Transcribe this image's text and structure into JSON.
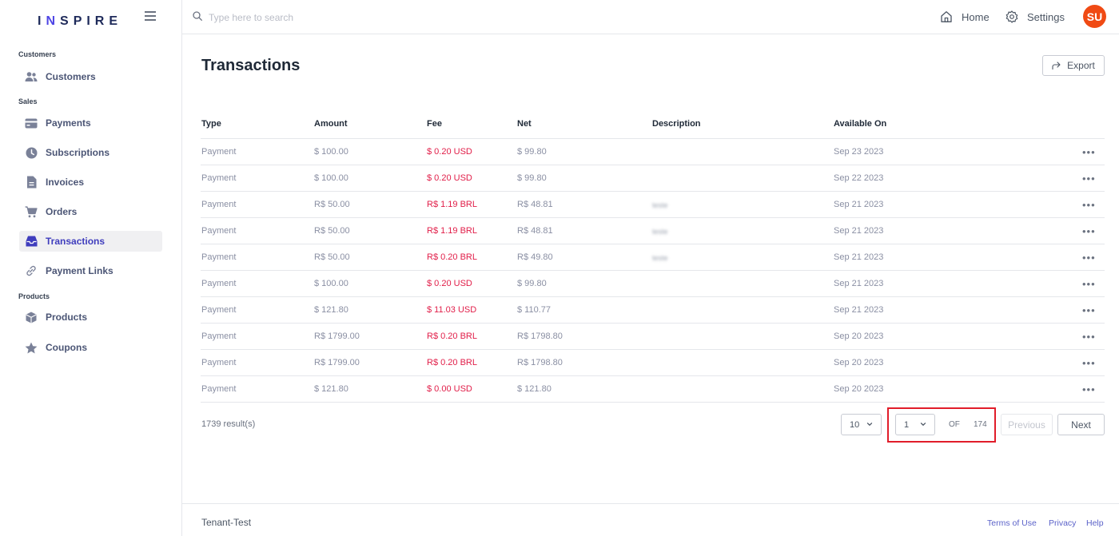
{
  "brand": {
    "prefix": "I",
    "accent": "N",
    "suffix": "SPIRE"
  },
  "sidebar": {
    "sections": [
      {
        "label": "Customers",
        "items": [
          {
            "label": "Customers",
            "icon": "users-icon"
          }
        ]
      },
      {
        "label": "Sales",
        "items": [
          {
            "label": "Payments",
            "icon": "credit-card-icon"
          },
          {
            "label": "Subscriptions",
            "icon": "clock-icon"
          },
          {
            "label": "Invoices",
            "icon": "document-icon"
          },
          {
            "label": "Orders",
            "icon": "cart-icon"
          },
          {
            "label": "Transactions",
            "icon": "inbox-icon",
            "active": true
          },
          {
            "label": "Payment Links",
            "icon": "link-icon"
          }
        ]
      },
      {
        "label": "Products",
        "items": [
          {
            "label": "Products",
            "icon": "box-icon"
          },
          {
            "label": "Coupons",
            "icon": "star-icon"
          }
        ]
      }
    ]
  },
  "topbar": {
    "search_placeholder": "Type here to search",
    "home_label": "Home",
    "settings_label": "Settings",
    "avatar_initials": "SU"
  },
  "page": {
    "title": "Transactions",
    "export_label": "Export"
  },
  "table": {
    "columns": [
      "Type",
      "Amount",
      "Fee",
      "Net",
      "Description",
      "Available On"
    ],
    "rows": [
      {
        "type": "Payment",
        "amount": "$ 100.00",
        "fee": "$ 0.20 USD",
        "net": "$ 99.80",
        "description": "",
        "available_on": "Sep 23 2023"
      },
      {
        "type": "Payment",
        "amount": "$ 100.00",
        "fee": "$ 0.20 USD",
        "net": "$ 99.80",
        "description": "",
        "available_on": "Sep 22 2023"
      },
      {
        "type": "Payment",
        "amount": "R$ 50.00",
        "fee": "R$ 1.19 BRL",
        "net": "R$ 48.81",
        "description": "teste",
        "available_on": "Sep 21 2023"
      },
      {
        "type": "Payment",
        "amount": "R$ 50.00",
        "fee": "R$ 1.19 BRL",
        "net": "R$ 48.81",
        "description": "teste",
        "available_on": "Sep 21 2023"
      },
      {
        "type": "Payment",
        "amount": "R$ 50.00",
        "fee": "R$ 0.20 BRL",
        "net": "R$ 49.80",
        "description": "teste",
        "available_on": "Sep 21 2023"
      },
      {
        "type": "Payment",
        "amount": "$ 100.00",
        "fee": "$ 0.20 USD",
        "net": "$ 99.80",
        "description": "",
        "available_on": "Sep 21 2023"
      },
      {
        "type": "Payment",
        "amount": "$ 121.80",
        "fee": "$ 11.03 USD",
        "net": "$ 110.77",
        "description": "",
        "available_on": "Sep 21 2023"
      },
      {
        "type": "Payment",
        "amount": "R$ 1799.00",
        "fee": "R$ 0.20 BRL",
        "net": "R$ 1798.80",
        "description": "",
        "available_on": "Sep 20 2023"
      },
      {
        "type": "Payment",
        "amount": "R$ 1799.00",
        "fee": "R$ 0.20 BRL",
        "net": "R$ 1798.80",
        "description": "",
        "available_on": "Sep 20 2023"
      },
      {
        "type": "Payment",
        "amount": "$ 121.80",
        "fee": "$ 0.00 USD",
        "net": "$ 121.80",
        "description": "",
        "available_on": "Sep 20 2023"
      }
    ],
    "row_menu_label": "•••"
  },
  "pagination": {
    "results_text": "1739 result(s)",
    "page_size": "10",
    "current_page": "1",
    "of_label": "OF",
    "total_pages": "174",
    "previous_label": "Previous",
    "next_label": "Next"
  },
  "footer": {
    "tenant": "Tenant-Test",
    "terms_label": "Terms of Use",
    "privacy_label": "Privacy",
    "help_label": "Help"
  },
  "colors": {
    "accent": "#4f46e5",
    "fee_red": "#e11d48",
    "avatar_bg": "#f04a14",
    "highlight": "#e11d2a"
  }
}
